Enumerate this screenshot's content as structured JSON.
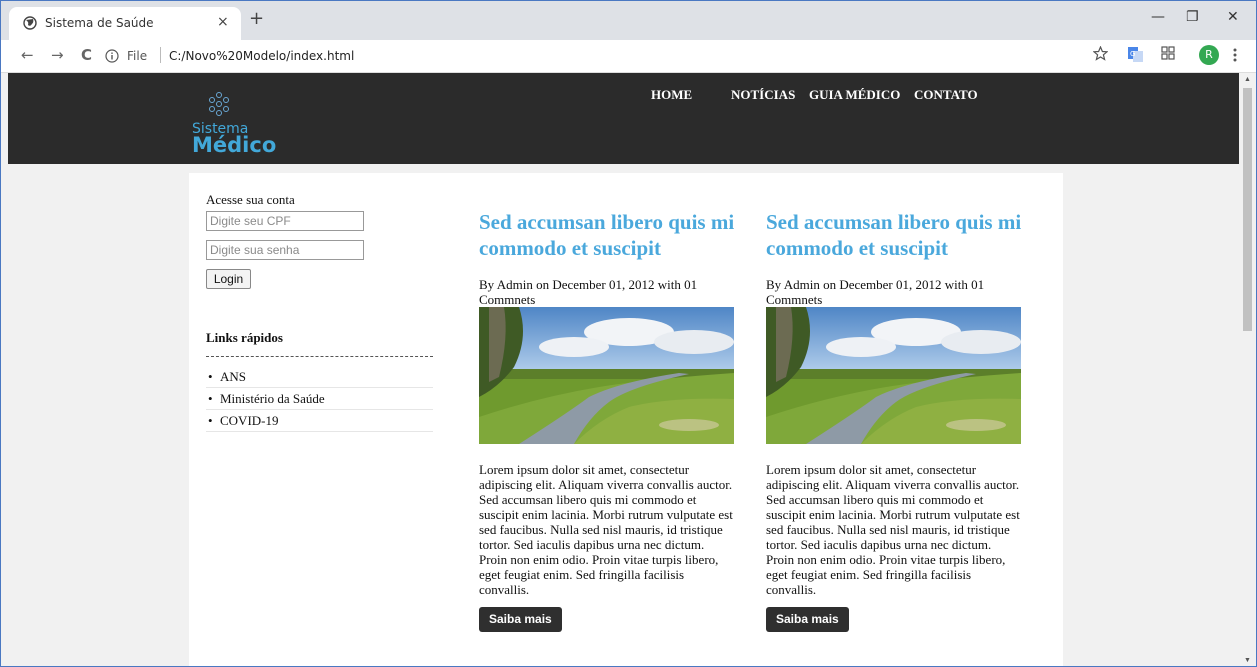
{
  "browser": {
    "tab_title": "Sistema de Saúde",
    "tab_close": "×",
    "new_tab": "+",
    "url_scheme": "File",
    "url": "C:/Novo%20Modelo/index.html",
    "avatar_initial": "R",
    "controls": {
      "minimize": "—",
      "maximize": "❐",
      "close": "✕"
    },
    "nav": {
      "back": "←",
      "forward": "→",
      "reload": "C"
    }
  },
  "site": {
    "logo_sub": "Sistema",
    "logo_main": "Médico",
    "nav": [
      {
        "label": "HOME"
      },
      {
        "label": "NOTÍCIAS"
      },
      {
        "label": "GUIA MÉDICO"
      },
      {
        "label": "CONTATO"
      }
    ]
  },
  "sidebar": {
    "login_title": "Acesse sua conta",
    "cpf_placeholder": "Digite seu CPF",
    "password_placeholder": "Digite sua senha",
    "login_button": "Login",
    "quick_links_title": "Links rápidos",
    "quick_links": [
      {
        "label": "ANS"
      },
      {
        "label": "Ministério da Saúde"
      },
      {
        "label": "COVID-19"
      }
    ]
  },
  "posts": [
    {
      "title": "Sed accumsan libero quis mi commodo et suscipit",
      "meta": "By Admin on December 01, 2012 with 01 Commnets",
      "body": "Lorem ipsum dolor sit amet, consectetur adipiscing elit. Aliquam viverra convallis auctor. Sed accumsan libero quis mi commodo et suscipit enim lacinia. Morbi rutrum vulputate est sed faucibus. Nulla sed nisl mauris, id tristique tortor. Sed iaculis dapibus urna nec dictum. Proin non enim odio. Proin vitae turpis libero, eget feugiat enim. Sed fringilla facilisis convallis.",
      "button": "Saiba mais"
    },
    {
      "title": "Sed accumsan libero quis mi commodo et suscipit",
      "meta": "By Admin on December 01, 2012 with 01 Commnets",
      "body": "Lorem ipsum dolor sit amet, consectetur adipiscing elit. Aliquam viverra convallis auctor. Sed accumsan libero quis mi commodo et suscipit enim lacinia. Morbi rutrum vulputate est sed faucibus. Nulla sed nisl mauris, id tristique tortor. Sed iaculis dapibus urna nec dictum. Proin non enim odio. Proin vitae turpis libero, eget feugiat enim. Sed fringilla facilisis convallis.",
      "button": "Saiba mais"
    }
  ],
  "colors": {
    "header_bg": "#2b2b2b",
    "accent": "#4aa8dc",
    "button_bg": "#2f2f2f"
  }
}
